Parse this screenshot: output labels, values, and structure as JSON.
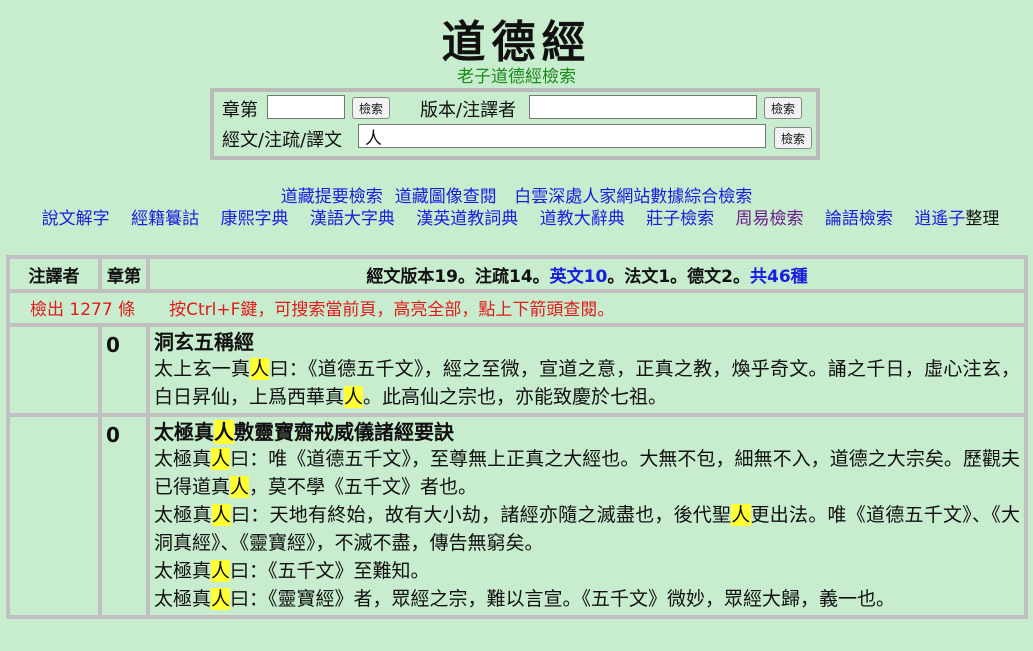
{
  "header": {
    "logo_text": "道德經",
    "subtitle": "老子道德經檢索"
  },
  "search": {
    "chapter_label": "章第",
    "chapter_value": "",
    "chapter_button": "檢索",
    "version_label": "版本/注譯者",
    "version_value": "",
    "version_button": "檢索",
    "text_label": "經文/注疏/譯文",
    "text_value": "人",
    "text_button": "檢索"
  },
  "links_row1": [
    "道藏提要檢索",
    "道藏圖像查閱",
    "白雲深處人家網站數據綜合檢索"
  ],
  "links_row2": [
    "說文解字",
    "經籍籑詁",
    "康熙字典",
    "漢語大字典",
    "漢英道教詞典",
    "道教大辭典",
    "莊子檢索",
    "周易檢索",
    "論語檢索",
    "逍遙子"
  ],
  "links_row2_tail": "整理",
  "table": {
    "col_annotator": "注譯者",
    "col_chapter": "章第",
    "summary_a": "經文版本19。注疏14。",
    "summary_b": "英文10",
    "summary_c": "。法文1。德文2。",
    "summary_d": "共46種",
    "result_count": "檢出 1277 條",
    "result_tip": "按Ctrl+F鍵，可搜索當前頁，高亮全部，點上下箭頭查閱。",
    "rows": [
      {
        "chapter": "0",
        "title_segments": [
          "洞玄五稱經"
        ],
        "lines": [
          [
            "太上玄一真",
            "人",
            "曰：《道德五千文》，經之至微，宣道之意，正真之教，煥乎奇文。誦之千日，虛心注玄，白日昇仙，上爲西華真",
            "人",
            "。此高仙之宗也，亦能致慶於七祖。"
          ]
        ]
      },
      {
        "chapter": "0",
        "title_segments": [
          "太極真",
          "人",
          "敷靈寶齋戒威儀諸經要訣"
        ],
        "lines": [
          [
            "太極真",
            "人",
            "曰：唯《道德五千文》，至尊無上正真之大經也。大無不包，細無不入，道德之大宗矣。歷觀夫已得道真",
            "人",
            "，莫不學《五千文》者也。"
          ],
          [
            "太極真",
            "人",
            "曰：天地有終始，故有大小劫，諸經亦隨之滅盡也，後代聖",
            "人",
            "更出法。唯《道德五千文》、《大洞真經》、《靈寶經》，不滅不盡，傳告無窮矣。"
          ],
          [
            "太極真",
            "人",
            "曰：《五千文》至難知。"
          ],
          [
            "太極真",
            "人",
            "曰：《靈寶經》者，眾經之宗，難以言宣。《五千文》微妙，眾經大歸，義一也。"
          ]
        ]
      }
    ]
  }
}
